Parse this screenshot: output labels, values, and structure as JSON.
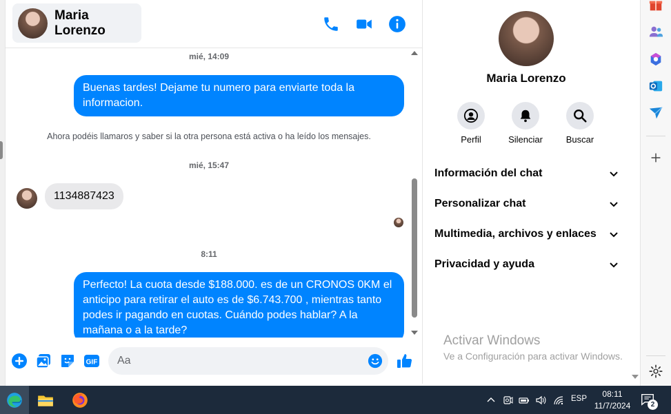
{
  "chat": {
    "contact_name": "Maria Lorenzo",
    "header_icons": [
      "phone-icon",
      "video-camera-icon",
      "info-icon"
    ],
    "messages": [
      {
        "type": "timestamp",
        "text": "mié, 14:09"
      },
      {
        "type": "outgoing",
        "text": "Buenas tardes! Dejame tu numero para enviarte toda la informacion."
      },
      {
        "type": "system",
        "text": "Ahora podéis llamaros y saber si la otra persona está activa o ha leído los mensajes."
      },
      {
        "type": "timestamp",
        "text": "mié, 15:47"
      },
      {
        "type": "incoming",
        "text": "1134887423"
      },
      {
        "type": "timestamp",
        "text": "8:11"
      },
      {
        "type": "outgoing",
        "text": "Perfecto! La cuota desde $188.000. es de un CRONOS 0KM el anticipo para retirar el auto es de $6.743.700 , mientras tanto podes ir pagando en cuotas. Cuándo podes hablar? A la mañana o a la tarde?"
      }
    ],
    "composer": {
      "placeholder": "Aa",
      "icons": [
        "plus-icon",
        "image-icon",
        "sticker-icon",
        "gif-icon",
        "emoji-icon",
        "thumbs-up-icon"
      ],
      "gif_label": "GIF"
    },
    "accent_color": "#0084ff"
  },
  "info_panel": {
    "name": "Maria Lorenzo",
    "actions": [
      {
        "label": "Perfil",
        "icon": "profile-icon"
      },
      {
        "label": "Silenciar",
        "icon": "bell-icon"
      },
      {
        "label": "Buscar",
        "icon": "search-icon"
      }
    ],
    "sections": [
      {
        "label": "Información del chat"
      },
      {
        "label": "Personalizar chat"
      },
      {
        "label": "Multimedia, archivos y enlaces"
      },
      {
        "label": "Privacidad y ayuda"
      }
    ],
    "watermark": {
      "line1": "Activar Windows",
      "line2": "Ve a Configuración para activar Windows."
    }
  },
  "edge_sidebar": {
    "icons": [
      "gift-icon",
      "people-icon",
      "copilot-icon",
      "outlook-icon",
      "send-icon",
      "add-icon",
      "settings-icon"
    ]
  },
  "taskbar": {
    "apps": [
      "edge-icon",
      "file-explorer-icon",
      "firefox-icon"
    ],
    "language": "ESP",
    "time": "08:11",
    "date": "11/7/2024",
    "notification_count": "2"
  }
}
